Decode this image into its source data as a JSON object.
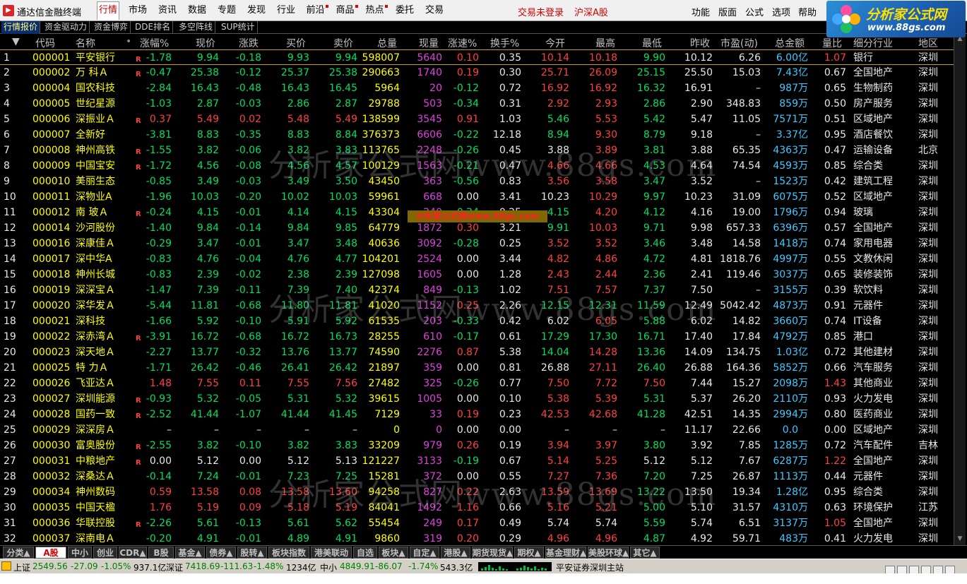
{
  "app": {
    "title": "通达信金融终端"
  },
  "menu": {
    "items": [
      {
        "label": "行情",
        "active": true
      },
      {
        "label": "市场"
      },
      {
        "label": "资讯"
      },
      {
        "label": "数据"
      },
      {
        "label": "专题"
      },
      {
        "label": "发现"
      },
      {
        "label": "行业"
      },
      {
        "label": "前沿"
      },
      {
        "label": "商品"
      },
      {
        "label": "热点"
      },
      {
        "label": "委托"
      },
      {
        "label": "交易"
      }
    ],
    "trade_status": "交易未登录",
    "market": "沪深A股",
    "right": [
      "功能",
      "版面",
      "公式",
      "选项",
      "帮助"
    ]
  },
  "brand": {
    "name": "分析家公式网",
    "url": "www.88gs.com"
  },
  "subtabs": [
    "行情报价",
    "资金驱动力",
    "资金博弈",
    "DDE排名",
    "多空阵线",
    "SUP统计"
  ],
  "headers": [
    "代码",
    "名称",
    "涨幅%",
    "现价",
    "涨跌",
    "买价",
    "卖价",
    "总量",
    "现量",
    "涨速%",
    "换手%",
    "今开",
    "最高",
    "最低",
    "昨收",
    "市盈(动)",
    "总金额",
    "量比",
    "细分行业",
    "地区"
  ],
  "rows": [
    {
      "n": "1",
      "code": "000001",
      "name": "平安银行",
      "r": true,
      "chg": "-1.78",
      "price": "9.94",
      "diff": "-0.18",
      "bid": "9.93",
      "ask": "9.94",
      "vol": "598007",
      "cur": "5640",
      "spd": "0.10",
      "turn": "0.35",
      "open": "10.14",
      "high": "10.18",
      "low": "9.90",
      "prev": "10.12",
      "pe": "6.26",
      "amt": "6.00",
      "unit": "亿",
      "vr": "1.07",
      "ind": "银行",
      "reg": "深圳"
    },
    {
      "n": "2",
      "code": "000002",
      "name": "万 科Ａ",
      "r": true,
      "chg": "-0.47",
      "price": "25.38",
      "diff": "-0.12",
      "bid": "25.37",
      "ask": "25.38",
      "vol": "290663",
      "cur": "1740",
      "spd": "0.19",
      "turn": "0.30",
      "open": "25.71",
      "high": "26.09",
      "low": "25.15",
      "prev": "25.50",
      "pe": "15.03",
      "amt": "7.43",
      "unit": "亿",
      "vr": "0.67",
      "ind": "全国地产",
      "reg": "深圳"
    },
    {
      "n": "3",
      "code": "000004",
      "name": "国农科技",
      "r": false,
      "chg": "-2.84",
      "price": "16.43",
      "diff": "-0.48",
      "bid": "16.43",
      "ask": "16.45",
      "vol": "5964",
      "cur": "20",
      "spd": "-0.12",
      "turn": "0.72",
      "open": "16.92",
      "high": "16.92",
      "low": "16.32",
      "prev": "16.91",
      "pe": "–",
      "amt": "987",
      "unit": "万",
      "vr": "0.65",
      "ind": "生物制药",
      "reg": "深圳"
    },
    {
      "n": "4",
      "code": "000005",
      "name": "世纪星源",
      "r": false,
      "chg": "-1.03",
      "price": "2.87",
      "diff": "-0.03",
      "bid": "2.86",
      "ask": "2.87",
      "vol": "29788",
      "cur": "503",
      "spd": "-0.34",
      "turn": "0.31",
      "open": "2.92",
      "high": "2.93",
      "low": "2.86",
      "prev": "2.90",
      "pe": "348.83",
      "amt": "859",
      "unit": "万",
      "vr": "0.50",
      "ind": "房产服务",
      "reg": "深圳"
    },
    {
      "n": "5",
      "code": "000006",
      "name": "深振业Ａ",
      "r": true,
      "chg": "0.37",
      "price": "5.49",
      "diff": "0.02",
      "bid": "5.48",
      "ask": "5.49",
      "vol": "138599",
      "cur": "3545",
      "spd": "0.91",
      "turn": "1.03",
      "open": "5.46",
      "high": "5.53",
      "low": "5.42",
      "prev": "5.47",
      "pe": "11.05",
      "amt": "7571",
      "unit": "万",
      "vr": "0.51",
      "ind": "区域地产",
      "reg": "深圳"
    },
    {
      "n": "6",
      "code": "000007",
      "name": "全新好",
      "r": false,
      "chg": "-3.81",
      "price": "8.83",
      "diff": "-0.35",
      "bid": "8.83",
      "ask": "8.84",
      "vol": "376373",
      "cur": "6606",
      "spd": "-0.22",
      "turn": "12.18",
      "open": "8.94",
      "high": "9.30",
      "low": "8.79",
      "prev": "9.18",
      "pe": "–",
      "amt": "3.37",
      "unit": "亿",
      "vr": "0.95",
      "ind": "酒店餐饮",
      "reg": "深圳"
    },
    {
      "n": "7",
      "code": "000008",
      "name": "神州高铁",
      "r": true,
      "chg": "-1.55",
      "price": "3.82",
      "diff": "-0.06",
      "bid": "3.82",
      "ask": "3.83",
      "vol": "113765",
      "cur": "2248",
      "spd": "-0.26",
      "turn": "0.45",
      "open": "3.88",
      "high": "3.89",
      "low": "3.81",
      "prev": "3.88",
      "pe": "65.35",
      "amt": "4363",
      "unit": "万",
      "vr": "0.47",
      "ind": "运输设备",
      "reg": "北京"
    },
    {
      "n": "8",
      "code": "000009",
      "name": "中国宝安",
      "r": true,
      "chg": "-1.72",
      "price": "4.56",
      "diff": "-0.08",
      "bid": "4.56",
      "ask": "4.57",
      "vol": "100129",
      "cur": "1563",
      "spd": "-0.21",
      "turn": "0.47",
      "open": "4.66",
      "high": "4.66",
      "low": "4.53",
      "prev": "4.64",
      "pe": "74.54",
      "amt": "4593",
      "unit": "万",
      "vr": "0.85",
      "ind": "综合类",
      "reg": "深圳"
    },
    {
      "n": "9",
      "code": "000010",
      "name": "美丽生态",
      "r": false,
      "chg": "-0.85",
      "price": "3.49",
      "diff": "-0.03",
      "bid": "3.49",
      "ask": "3.50",
      "vol": "43450",
      "cur": "363",
      "spd": "-0.56",
      "turn": "0.83",
      "open": "3.56",
      "high": "3.58",
      "low": "3.47",
      "prev": "3.52",
      "pe": "–",
      "amt": "1523",
      "unit": "万",
      "vr": "0.42",
      "ind": "建筑工程",
      "reg": "深圳"
    },
    {
      "n": "10",
      "code": "000011",
      "name": "深物业A",
      "r": false,
      "chg": "-1.96",
      "price": "10.03",
      "diff": "-0.20",
      "bid": "10.02",
      "ask": "10.03",
      "vol": "59961",
      "cur": "668",
      "spd": "0.00",
      "turn": "3.41",
      "open": "10.23",
      "high": "10.29",
      "low": "9.97",
      "prev": "10.23",
      "pe": "31.09",
      "amt": "6075",
      "unit": "万",
      "vr": "0.52",
      "ind": "区域地产",
      "reg": "深圳"
    },
    {
      "n": "11",
      "code": "000012",
      "name": "南 玻Ａ",
      "r": true,
      "chg": "-0.24",
      "price": "4.15",
      "diff": "-0.01",
      "bid": "4.14",
      "ask": "4.15",
      "vol": "43304",
      "cur": "240",
      "spd": "-0.24",
      "turn": "0.25",
      "open": "4.15",
      "high": "4.20",
      "low": "4.12",
      "prev": "4.16",
      "pe": "19.00",
      "amt": "1796",
      "unit": "万",
      "vr": "0.94",
      "ind": "玻璃",
      "reg": "深圳"
    },
    {
      "n": "12",
      "code": "000014",
      "name": "沙河股份",
      "r": false,
      "chg": "-1.40",
      "price": "9.84",
      "diff": "-0.14",
      "bid": "9.84",
      "ask": "9.85",
      "vol": "64779",
      "cur": "1872",
      "spd": "0.30",
      "turn": "3.21",
      "open": "9.91",
      "high": "10.03",
      "low": "9.71",
      "prev": "9.98",
      "pe": "657.33",
      "amt": "6396",
      "unit": "万",
      "vr": "0.57",
      "ind": "全国地产",
      "reg": "深圳"
    },
    {
      "n": "13",
      "code": "000016",
      "name": "深康佳Ａ",
      "r": false,
      "chg": "-0.29",
      "price": "3.47",
      "diff": "-0.01",
      "bid": "3.47",
      "ask": "3.48",
      "vol": "40636",
      "cur": "3092",
      "spd": "-0.28",
      "turn": "0.25",
      "open": "3.52",
      "high": "3.52",
      "low": "3.46",
      "prev": "3.48",
      "pe": "14.58",
      "amt": "1418",
      "unit": "万",
      "vr": "0.74",
      "ind": "家用电器",
      "reg": "深圳"
    },
    {
      "n": "14",
      "code": "000017",
      "name": "深中华A",
      "r": false,
      "chg": "-0.83",
      "price": "4.76",
      "diff": "-0.04",
      "bid": "4.76",
      "ask": "4.77",
      "vol": "104201",
      "cur": "2524",
      "spd": "0.00",
      "turn": "3.44",
      "open": "4.82",
      "high": "4.86",
      "low": "4.72",
      "prev": "4.81",
      "pe": "1818.76",
      "amt": "4997",
      "unit": "万",
      "vr": "0.55",
      "ind": "文教休闲",
      "reg": "深圳"
    },
    {
      "n": "15",
      "code": "000018",
      "name": "神州长城",
      "r": false,
      "chg": "-0.83",
      "price": "2.39",
      "diff": "-0.02",
      "bid": "2.38",
      "ask": "2.39",
      "vol": "127098",
      "cur": "1605",
      "spd": "0.00",
      "turn": "1.28",
      "open": "2.43",
      "high": "2.44",
      "low": "2.36",
      "prev": "2.41",
      "pe": "119.46",
      "amt": "3037",
      "unit": "万",
      "vr": "0.65",
      "ind": "装修装饰",
      "reg": "深圳"
    },
    {
      "n": "16",
      "code": "000019",
      "name": "深深宝Ａ",
      "r": false,
      "chg": "-1.47",
      "price": "7.39",
      "diff": "-0.11",
      "bid": "7.39",
      "ask": "7.40",
      "vol": "42374",
      "cur": "849",
      "spd": "-0.13",
      "turn": "1.02",
      "open": "7.51",
      "high": "7.57",
      "low": "7.37",
      "prev": "7.50",
      "pe": "–",
      "amt": "3155",
      "unit": "万",
      "vr": "0.39",
      "ind": "软饮料",
      "reg": "深圳"
    },
    {
      "n": "17",
      "code": "000020",
      "name": "深华发Ａ",
      "r": false,
      "chg": "-5.44",
      "price": "11.81",
      "diff": "-0.68",
      "bid": "11.80",
      "ask": "11.81",
      "vol": "41020",
      "cur": "1152",
      "spd": "0.25",
      "turn": "2.26",
      "open": "12.15",
      "high": "12.31",
      "low": "11.59",
      "prev": "12.49",
      "pe": "5042.42",
      "amt": "4873",
      "unit": "万",
      "vr": "0.91",
      "ind": "元器件",
      "reg": "深圳"
    },
    {
      "n": "18",
      "code": "000021",
      "name": "深科技",
      "r": false,
      "chg": "-1.66",
      "price": "5.92",
      "diff": "-0.10",
      "bid": "5.91",
      "ask": "5.92",
      "vol": "61535",
      "cur": "203",
      "spd": "-0.33",
      "turn": "0.42",
      "open": "6.02",
      "high": "6.05",
      "low": "5.88",
      "prev": "6.02",
      "pe": "14.82",
      "amt": "3660",
      "unit": "万",
      "vr": "0.74",
      "ind": "IT设备",
      "reg": "深圳"
    },
    {
      "n": "19",
      "code": "000022",
      "name": "深赤湾Ａ",
      "r": true,
      "chg": "-3.91",
      "price": "16.72",
      "diff": "-0.68",
      "bid": "16.72",
      "ask": "16.73",
      "vol": "28255",
      "cur": "610",
      "spd": "-0.17",
      "turn": "0.61",
      "open": "17.29",
      "high": "17.30",
      "low": "16.71",
      "prev": "17.40",
      "pe": "17.84",
      "amt": "4792",
      "unit": "万",
      "vr": "0.85",
      "ind": "港口",
      "reg": "深圳"
    },
    {
      "n": "20",
      "code": "000023",
      "name": "深天地Ａ",
      "r": false,
      "chg": "-2.27",
      "price": "13.77",
      "diff": "-0.32",
      "bid": "13.76",
      "ask": "13.77",
      "vol": "74590",
      "cur": "2276",
      "spd": "0.87",
      "turn": "5.38",
      "open": "14.04",
      "high": "14.28",
      "low": "13.36",
      "prev": "14.09",
      "pe": "134.75",
      "amt": "1.03",
      "unit": "亿",
      "vr": "0.72",
      "ind": "其他建材",
      "reg": "深圳"
    },
    {
      "n": "21",
      "code": "000025",
      "name": "特 力Ａ",
      "r": false,
      "chg": "-1.71",
      "price": "26.42",
      "diff": "-0.46",
      "bid": "26.41",
      "ask": "26.42",
      "vol": "21897",
      "cur": "359",
      "spd": "0.00",
      "turn": "0.81",
      "open": "26.88",
      "high": "27.11",
      "low": "26.40",
      "prev": "26.88",
      "pe": "164.36",
      "amt": "5852",
      "unit": "万",
      "vr": "0.66",
      "ind": "汽车服务",
      "reg": "深圳"
    },
    {
      "n": "22",
      "code": "000026",
      "name": "飞亚达Ａ",
      "r": false,
      "chg": "1.48",
      "price": "7.55",
      "diff": "0.11",
      "bid": "7.55",
      "ask": "7.56",
      "vol": "27482",
      "cur": "325",
      "spd": "-0.26",
      "turn": "0.77",
      "open": "7.50",
      "high": "7.72",
      "low": "7.50",
      "prev": "7.44",
      "pe": "15.27",
      "amt": "2098",
      "unit": "万",
      "vr": "1.43",
      "ind": "其他商业",
      "reg": "深圳"
    },
    {
      "n": "23",
      "code": "000027",
      "name": "深圳能源",
      "r": true,
      "chg": "-0.93",
      "price": "5.32",
      "diff": "-0.05",
      "bid": "5.31",
      "ask": "5.32",
      "vol": "39615",
      "cur": "1005",
      "spd": "0.00",
      "turn": "0.10",
      "open": "5.38",
      "high": "5.39",
      "low": "5.31",
      "prev": "5.37",
      "pe": "26.20",
      "amt": "2110",
      "unit": "万",
      "vr": "0.93",
      "ind": "火力发电",
      "reg": "深圳"
    },
    {
      "n": "24",
      "code": "000028",
      "name": "国药一致",
      "r": true,
      "chg": "-2.52",
      "price": "41.44",
      "diff": "-1.07",
      "bid": "41.44",
      "ask": "41.45",
      "vol": "7129",
      "cur": "33",
      "spd": "0.19",
      "turn": "0.23",
      "open": "42.53",
      "high": "42.68",
      "low": "41.28",
      "prev": "42.51",
      "pe": "14.35",
      "amt": "2994",
      "unit": "万",
      "vr": "0.80",
      "ind": "医药商业",
      "reg": "深圳"
    },
    {
      "n": "25",
      "code": "000029",
      "name": "深深房Ａ",
      "r": false,
      "chg": "–",
      "price": "–",
      "diff": "–",
      "bid": "–",
      "ask": "–",
      "vol": "0",
      "cur": "0",
      "spd": "0.00",
      "turn": "0.00",
      "open": "–",
      "high": "–",
      "low": "–",
      "prev": "11.17",
      "pe": "22.66",
      "amt": "0.0",
      "unit": "",
      "vr": "0.00",
      "ind": "区域地产",
      "reg": "深圳"
    },
    {
      "n": "26",
      "code": "000030",
      "name": "富奥股份",
      "r": true,
      "chg": "-2.55",
      "price": "3.82",
      "diff": "-0.10",
      "bid": "3.82",
      "ask": "3.83",
      "vol": "33209",
      "cur": "979",
      "spd": "0.26",
      "turn": "0.19",
      "open": "3.94",
      "high": "3.97",
      "low": "3.80",
      "prev": "3.92",
      "pe": "7.85",
      "amt": "1285",
      "unit": "万",
      "vr": "0.72",
      "ind": "汽车配件",
      "reg": "吉林"
    },
    {
      "n": "27",
      "code": "000031",
      "name": "中粮地产",
      "r": true,
      "chg": "0.00",
      "price": "5.12",
      "diff": "0.00",
      "bid": "5.12",
      "ask": "5.13",
      "vol": "121227",
      "cur": "3133",
      "spd": "-0.19",
      "turn": "0.67",
      "open": "5.14",
      "high": "5.25",
      "low": "5.12",
      "prev": "5.12",
      "pe": "7.67",
      "amt": "6287",
      "unit": "万",
      "vr": "1.22",
      "ind": "全国地产",
      "reg": "深圳"
    },
    {
      "n": "28",
      "code": "000032",
      "name": "深桑达Ａ",
      "r": false,
      "chg": "-0.14",
      "price": "7.24",
      "diff": "-0.01",
      "bid": "7.23",
      "ask": "7.25",
      "vol": "15281",
      "cur": "372",
      "spd": "0.00",
      "turn": "0.55",
      "open": "7.27",
      "high": "7.36",
      "low": "7.20",
      "prev": "7.25",
      "pe": "26.87",
      "amt": "1113",
      "unit": "万",
      "vr": "0.44",
      "ind": "元器件",
      "reg": "深圳"
    },
    {
      "n": "29",
      "code": "000034",
      "name": "神州数码",
      "r": false,
      "chg": "0.59",
      "price": "13.58",
      "diff": "0.08",
      "bid": "13.58",
      "ask": "13.60",
      "vol": "94258",
      "cur": "827",
      "spd": "0.22",
      "turn": "2.63",
      "open": "13.59",
      "high": "13.69",
      "low": "13.22",
      "prev": "13.50",
      "pe": "19.34",
      "amt": "1.28",
      "unit": "亿",
      "vr": "0.95",
      "ind": "综合类",
      "reg": "深圳"
    },
    {
      "n": "30",
      "code": "000035",
      "name": "中国天楹",
      "r": false,
      "chg": "1.76",
      "price": "5.19",
      "diff": "0.09",
      "bid": "5.18",
      "ask": "5.19",
      "vol": "84041",
      "cur": "1492",
      "spd": "1.16",
      "turn": "0.66",
      "open": "5.16",
      "high": "5.21",
      "low": "5.00",
      "prev": "5.10",
      "pe": "31.57",
      "amt": "4310",
      "unit": "万",
      "vr": "0.63",
      "ind": "环境保护",
      "reg": "江苏"
    },
    {
      "n": "31",
      "code": "000036",
      "name": "华联控股",
      "r": true,
      "chg": "-2.26",
      "price": "5.61",
      "diff": "-0.13",
      "bid": "5.61",
      "ask": "5.62",
      "vol": "55454",
      "cur": "249",
      "spd": "0.17",
      "turn": "0.49",
      "open": "5.74",
      "high": "5.74",
      "low": "5.59",
      "prev": "5.74",
      "pe": "6.51",
      "amt": "3137",
      "unit": "万",
      "vr": "1.05",
      "ind": "全国地产",
      "reg": "深圳"
    },
    {
      "n": "32",
      "code": "000037",
      "name": "深南电Ａ",
      "r": false,
      "chg": "-0.20",
      "price": "4.91",
      "diff": "-0.01",
      "bid": "4.89",
      "ask": "4.91",
      "vol": "9860",
      "cur": "319",
      "spd": "0.20",
      "turn": "0.29",
      "open": "4.96",
      "high": "4.96",
      "low": "4.87",
      "prev": "4.92",
      "pe": "59.71",
      "amt": "483",
      "unit": "万",
      "vr": "0.41",
      "ind": "火力发电",
      "reg": "深圳"
    }
  ],
  "watermark": {
    "overlay": "分析家公式网www.88gs.com",
    "large": "分析家公式网www.88gs.com"
  },
  "bottom_tabs": [
    {
      "label": "分类▲"
    },
    {
      "label": "A股",
      "active": true
    },
    {
      "label": "中小"
    },
    {
      "label": "创业"
    },
    {
      "label": "CDR▲"
    },
    {
      "label": "B股"
    },
    {
      "label": "基金▲"
    },
    {
      "label": "债券▲"
    },
    {
      "label": "股转▲"
    },
    {
      "label": "板块指数"
    },
    {
      "label": "港美联动"
    },
    {
      "label": "自选"
    },
    {
      "label": "板块▲"
    },
    {
      "label": "自定▲"
    },
    {
      "label": "港股▲"
    },
    {
      "label": "期货现货▲"
    },
    {
      "label": "期权▲"
    },
    {
      "label": "基金理财▲"
    },
    {
      "label": "美股环球▲"
    },
    {
      "label": "其它▲"
    }
  ],
  "status": {
    "sh_label": "上证",
    "sh_val": "2549.56",
    "sh_chg": "-27.09",
    "sh_pct": "-1.05%",
    "sh_amt": "937.1亿",
    "sz_label": "深证",
    "sz_val": "7418.69",
    "sz_chg": "-111.63",
    "sz_pct": "-1.48%",
    "sz_amt": "1234亿",
    "zx_label": "中小",
    "zx_val": "4849.91",
    "zx_chg": "-86.07",
    "zx_pct": "-1.74%",
    "zx_amt": "543.3亿",
    "server": "平安证券深圳主站"
  },
  "colors": {
    "up": "#ff4040",
    "down": "#00e060",
    "code": "#ffff00",
    "amount": "#40c8ff",
    "volume": "#e040e0"
  }
}
